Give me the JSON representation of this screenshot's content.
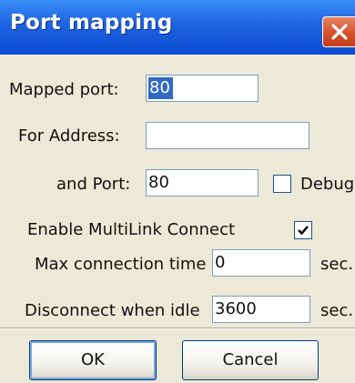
{
  "window": {
    "title": "Port mapping"
  },
  "form": {
    "mapped_port": {
      "label": "Mapped port:",
      "value": "80",
      "selected": true
    },
    "for_address": {
      "label": "For Address:",
      "value": ""
    },
    "and_port": {
      "label": "and Port:",
      "value": "80"
    },
    "debug": {
      "label": "Debug it",
      "checked": false
    },
    "multilink": {
      "label": "Enable MultiLink Connect",
      "checked": true
    },
    "max_connection_time": {
      "label": "Max connection time",
      "value": "0",
      "unit": "sec."
    },
    "disconnect_idle": {
      "label": "Disconnect when idle",
      "value": "3600",
      "unit": "sec."
    }
  },
  "buttons": {
    "ok_label": "OK",
    "cancel_label": "Cancel"
  },
  "colors": {
    "titlebar_blue": "#0b4bd2",
    "close_red": "#d6512c",
    "dialog_bg": "#ece9d8",
    "selection_blue": "#316ac5"
  },
  "icons": {
    "close": "close-x-icon",
    "checkmark": "checkmark-icon"
  }
}
